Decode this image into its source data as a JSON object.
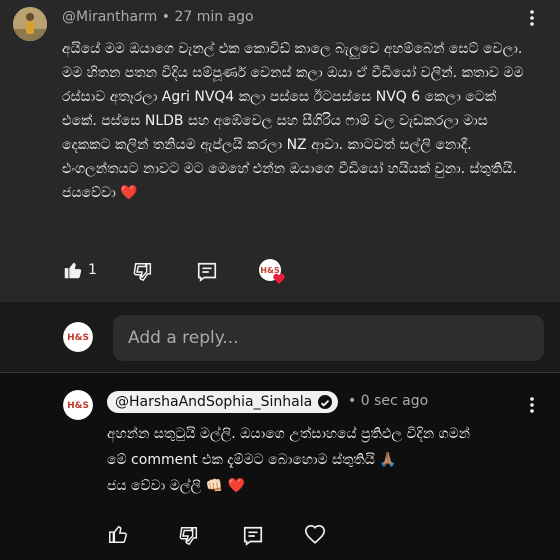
{
  "comment": {
    "author": "@Mirantharm",
    "time": "27 min ago",
    "text": "අයියේ මම ඔයාගෙ වැනල් එක කොවිඩ් කාලෙ බැලුවෙ අහම්බෙන් සෙට් වෙලා. මම හිතන පතන විදිය සම්පූර්ණ වෙනස් කලා ඔයා  ඒ වීඩියෝ වලින්. කතාව මම රස්සාව අතෑරලා Agri NVQ4 කලා පස්සෙ ඊටපස්සෙ NVQ 6 කෙලා ටෙක් එකේ. පස්සෙ NLDB සහ අඹේවෙල සහ සීගිරිය ෆාම් වල වැඩකරලා මාස දෙකකට කලින් තනියම ඇප්ලයි කරලා NZ ආවා. කාටවත් සල්ලි නොදී. එංගලන්තයට නාවට මට මෙහේ එන්න ඔයාගෙ වීඩියෝ හයියක් වුනා. ස්තුතියි. ජයවේවා ❤️",
    "like_count": "1"
  },
  "reply_input": {
    "placeholder": "Add a reply..."
  },
  "reply": {
    "author": "@HarshaAndSophia_Sinhala",
    "time": "0 sec ago",
    "line1": "අහන්න සතුටුයි මල්ලි. ඔයාගෙ උත්සාහයේ ප්‍රතිඵල විදින ගමන්",
    "line2": "මේ comment එක දැම්මට බොහොම ස්තුතියි 🙏🏽",
    "line3": "ජය වේවා මල්ලි 👊🏻 ❤️"
  },
  "avatars": {
    "channel_logo_text": "H&S"
  },
  "colors": {
    "background": "#0f0f0f",
    "comment_bg": "#282828",
    "heart": "#e91e3c"
  }
}
